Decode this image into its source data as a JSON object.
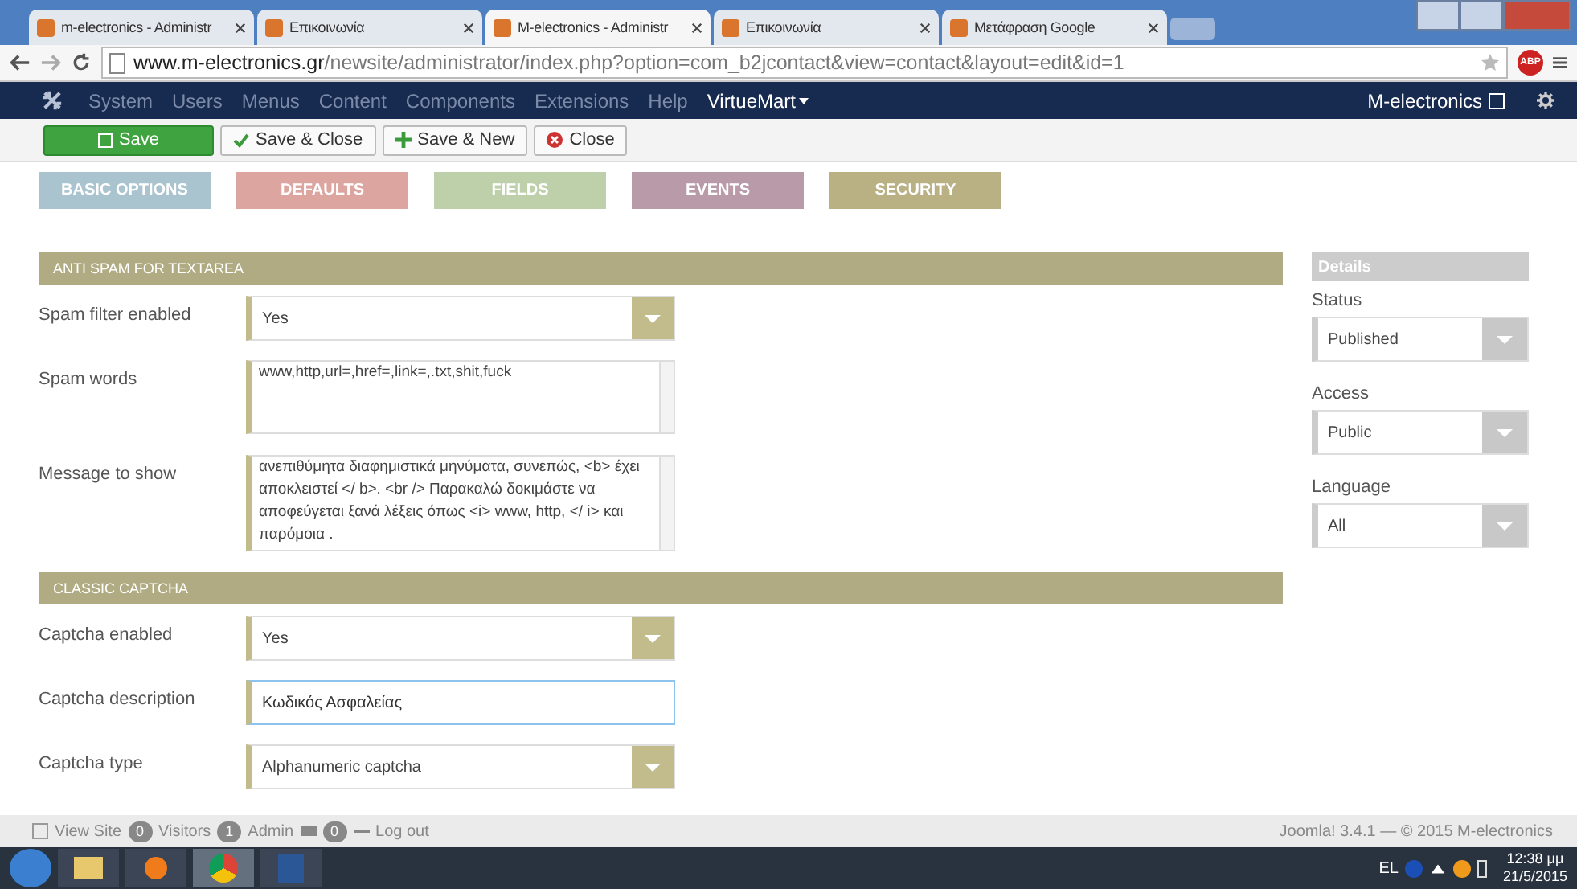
{
  "browser": {
    "tabs": [
      {
        "title": "m-electronics - Administr",
        "selected": false
      },
      {
        "title": "Επικοινωνία",
        "selected": false
      },
      {
        "title": "M-electronics - Administr",
        "selected": true
      },
      {
        "title": "Επικοινωνία",
        "selected": false
      },
      {
        "title": "Μετάφραση Google",
        "selected": false
      }
    ],
    "url_host": "www.m-electronics.gr",
    "url_path": "/newsite/administrator/index.php?option=com_b2jcontact&view=contact&layout=edit&id=1",
    "extension": "ABP"
  },
  "navbar": {
    "menu": [
      "System",
      "Users",
      "Menus",
      "Content",
      "Components",
      "Extensions",
      "Help"
    ],
    "extra_menu": "VirtueMart",
    "site_link": "M-electronics"
  },
  "toolbar": [
    {
      "label": "Save",
      "kind": "primary"
    },
    {
      "label": "Save & Close",
      "kind": "check"
    },
    {
      "label": "Save & New",
      "kind": "plus"
    },
    {
      "label": "Close",
      "kind": "close"
    }
  ],
  "section_tabs": [
    {
      "label": "BASIC OPTIONS",
      "color": "#a9c3cf"
    },
    {
      "label": "DEFAULTS",
      "color": "#dca5a0"
    },
    {
      "label": "FIELDS",
      "color": "#bdd0a9"
    },
    {
      "label": "EVENTS",
      "color": "#b99aa8"
    },
    {
      "label": "SECURITY",
      "color": "#b9b084"
    }
  ],
  "sections": [
    {
      "title": "ANTI SPAM FOR TEXTAREA",
      "fields": [
        {
          "label": "Spam filter enabled",
          "kind": "select",
          "value": "Yes"
        },
        {
          "label": "Spam words",
          "kind": "textarea",
          "value": "www,http,url=,href=,link=,.txt,shit,fuck"
        },
        {
          "label": "Message to show",
          "kind": "textarea",
          "value": "ανεπιθύμητα διαφημιστικά μηνύματα, συνεπώς, <b> έχει αποκλειστεί </ b>. <br /> Παρακαλώ δοκιμάστε να αποφεύγεται ξανά λέξεις όπως <i> www, http, </ i> και παρόμοια ."
        }
      ]
    },
    {
      "title": "CLASSIC CAPTCHA",
      "fields": [
        {
          "label": "Captcha enabled",
          "kind": "select",
          "value": "Yes"
        },
        {
          "label": "Captcha description",
          "kind": "input",
          "value": "Κωδικός Ασφαλείας"
        },
        {
          "label": "Captcha type",
          "kind": "select",
          "value": "Alphanumeric captcha"
        }
      ]
    }
  ],
  "details": {
    "title": "Details",
    "fields": [
      {
        "label": "Status",
        "value": "Published"
      },
      {
        "label": "Access",
        "value": "Public"
      },
      {
        "label": "Language",
        "value": "All"
      }
    ]
  },
  "status_bar": {
    "view_site": "View Site",
    "visitors_count": "0",
    "visitors": "Visitors",
    "admin_count": "1",
    "admin": "Admin",
    "messages_count": "0",
    "logout": "Log out",
    "version": "Joomla! 3.4.1 — © 2015 M-electronics"
  },
  "taskbar": {
    "language": "EL",
    "time": "12:38 μμ",
    "date": "21/5/2015"
  }
}
